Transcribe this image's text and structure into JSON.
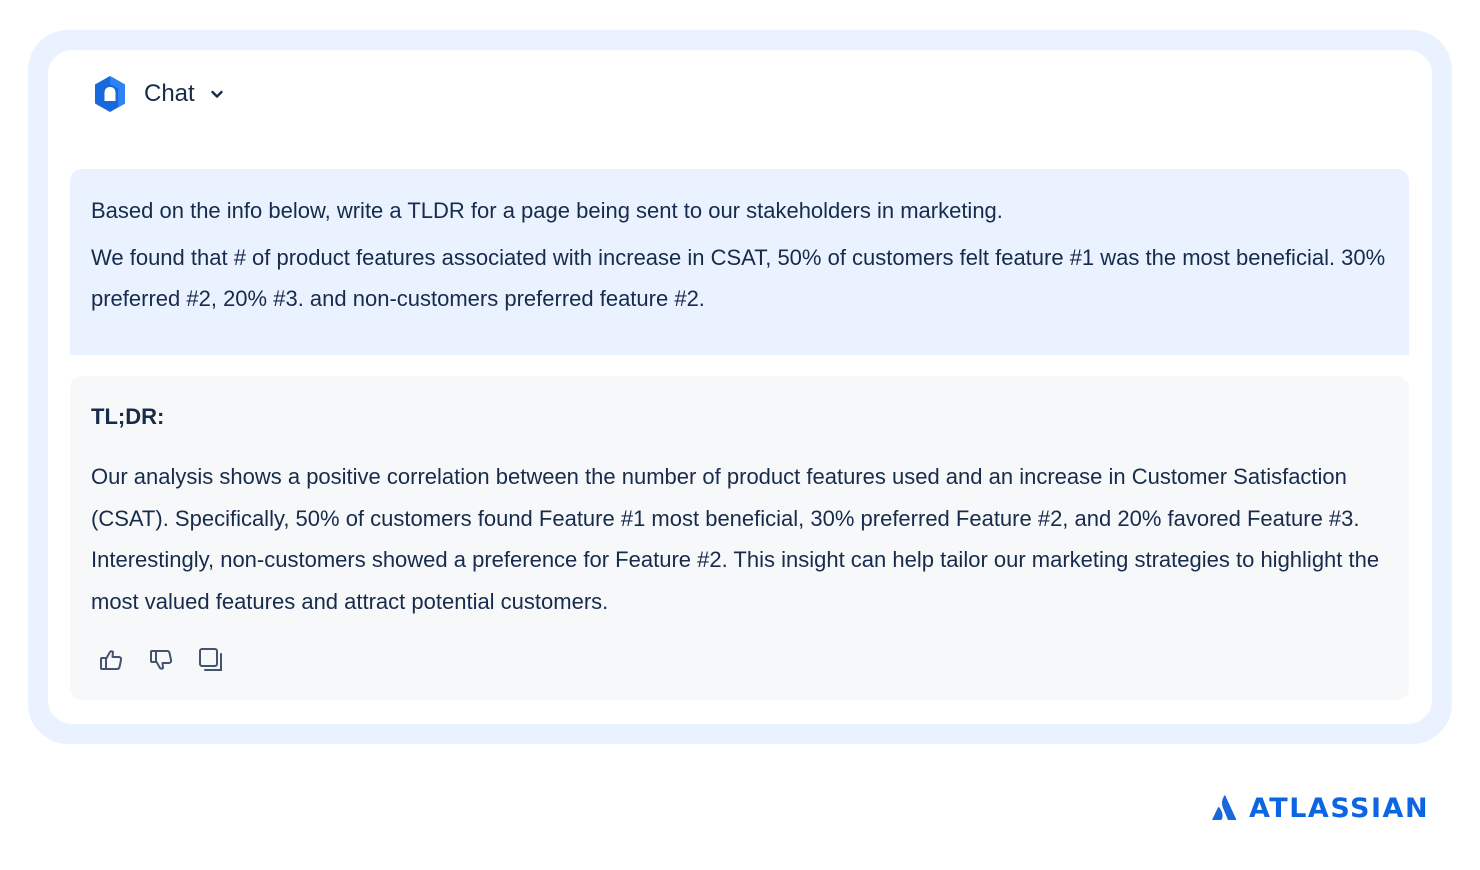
{
  "header": {
    "title": "Chat",
    "logo_icon": "atlassian-intelligence-icon",
    "dropdown_icon": "chevron-down-icon"
  },
  "user_message": {
    "paragraphs": [
      "Based on the info below, write a TLDR for a page being sent to our stakeholders in marketing.",
      "We found that # of product features associated with increase in CSAT, 50% of customers felt feature #1 was the most beneficial. 30% preferred #2, 20% #3. and non-customers preferred feature #2."
    ]
  },
  "ai_response": {
    "heading": "TL;DR:",
    "body": "Our analysis shows a positive correlation between the number of product features used and an increase in Customer Satisfaction (CSAT). Specifically, 50% of customers found Feature #1 most beneficial, 30% preferred Feature #2, and 20% favored Feature #3. Interestingly, non-customers showed a preference for Feature #2. This insight can help tailor our marketing strategies to highlight the most valued features and attract potential customers.",
    "actions": [
      "thumbs-up-icon",
      "thumbs-down-icon",
      "copy-icon"
    ]
  },
  "brand": {
    "name": "ATLASSIAN",
    "icon": "atlassian-logo-icon"
  },
  "colors": {
    "accent": "#0c66e4",
    "frame": "#e9f2fe",
    "response_bg": "#f7f8f9",
    "text": "#172b4d"
  }
}
